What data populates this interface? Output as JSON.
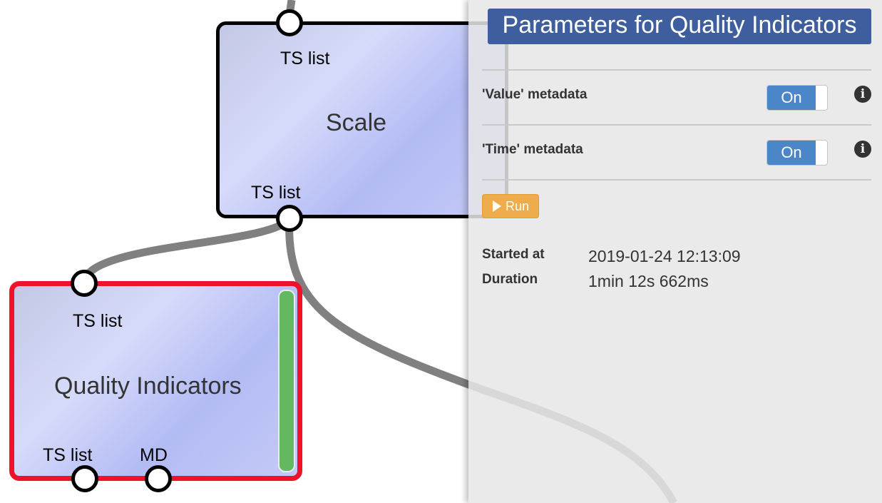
{
  "workflow": {
    "nodes": {
      "scale": {
        "title": "Scale",
        "input_label": "TS list",
        "output_label": "TS list"
      },
      "quality_indicators": {
        "title": "Quality Indicators",
        "input_label": "TS list",
        "outputs": [
          "TS list",
          "MD"
        ]
      }
    }
  },
  "panel": {
    "title": "Parameters for Quality Indicators",
    "params": [
      {
        "label": "'Value' metadata",
        "toggle": "On"
      },
      {
        "label": "'Time' metadata",
        "toggle": "On"
      }
    ],
    "run_label": "Run",
    "info": {
      "started_label": "Started at",
      "started_value": "2019-01-24 12:13:09",
      "duration_label": "Duration",
      "duration_value": "1min 12s 662ms"
    }
  },
  "colors": {
    "panel_title_bg": "#3f5e9e",
    "toggle_on": "#4a86c8",
    "run_button": "#eeac4d",
    "selected_node_border": "#f0122a",
    "status_ok": "#63b860",
    "link": "#7f7f7f"
  }
}
